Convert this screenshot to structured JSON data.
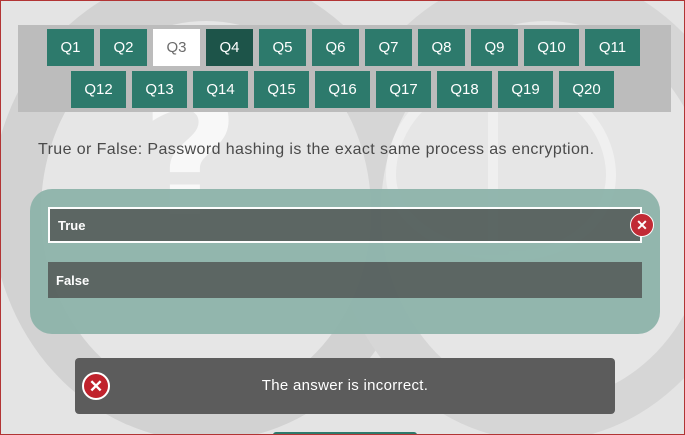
{
  "question_nav": {
    "row1": [
      "Q1",
      "Q2",
      "Q3",
      "Q4",
      "Q5",
      "Q6",
      "Q7",
      "Q8",
      "Q9",
      "Q10",
      "Q11"
    ],
    "row2": [
      "Q12",
      "Q13",
      "Q14",
      "Q15",
      "Q16",
      "Q17",
      "Q18",
      "Q19",
      "Q20"
    ],
    "highlighted": "Q3",
    "current": "Q4"
  },
  "question": {
    "text": "True or False: Password hashing is the exact same process as encryption."
  },
  "options": [
    {
      "label": "True",
      "selected": true,
      "status": "incorrect"
    },
    {
      "label": "False",
      "selected": false
    }
  ],
  "feedback": {
    "text": "The answer is incorrect.",
    "icon": "close-icon"
  },
  "colors": {
    "nav_button": "#2d7a6c",
    "nav_current": "#1d5449",
    "answer_panel": "#8eb4ab",
    "option_bg": "#55605d",
    "incorrect": "#c0222c",
    "feedback_bg": "#5c5c5c"
  },
  "glyphs": {
    "background_question_mark": "?",
    "close": "✕"
  }
}
